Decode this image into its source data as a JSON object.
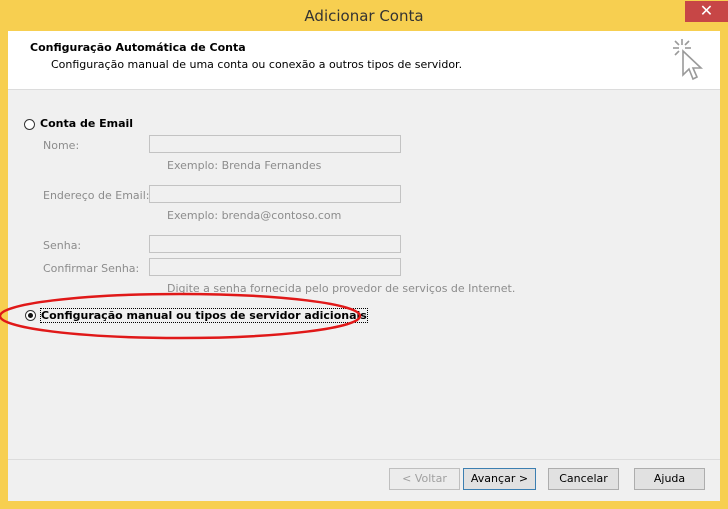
{
  "window": {
    "title": "Adicionar Conta",
    "close_glyph": "✕"
  },
  "header": {
    "title": "Configuração Automática de Conta",
    "subtitle": "Configuração manual de uma conta ou conexão a outros tipos de servidor."
  },
  "options": {
    "email_account": {
      "label": "Conta de Email",
      "selected": false
    },
    "manual_setup": {
      "label": "Configuração manual ou tipos de servidor adicionais",
      "selected": true
    }
  },
  "fields": {
    "name": {
      "label": "Nome:",
      "value": "",
      "hint": "Exemplo: Brenda Fernandes"
    },
    "email": {
      "label": "Endereço de Email:",
      "value": "",
      "hint": "Exemplo: brenda@contoso.com"
    },
    "password": {
      "label": "Senha:",
      "value": ""
    },
    "confirm_password": {
      "label": "Confirmar Senha:",
      "value": "",
      "hint": "Digite a senha fornecida pelo provedor de serviços de Internet."
    }
  },
  "buttons": {
    "back": "< Voltar",
    "next": "Avançar >",
    "cancel": "Cancelar",
    "help": "Ajuda"
  },
  "colors": {
    "title_bar": "#f7cf50",
    "annotation_ellipse": "#e01818"
  },
  "icons": {
    "header": "cursor-click-icon"
  }
}
